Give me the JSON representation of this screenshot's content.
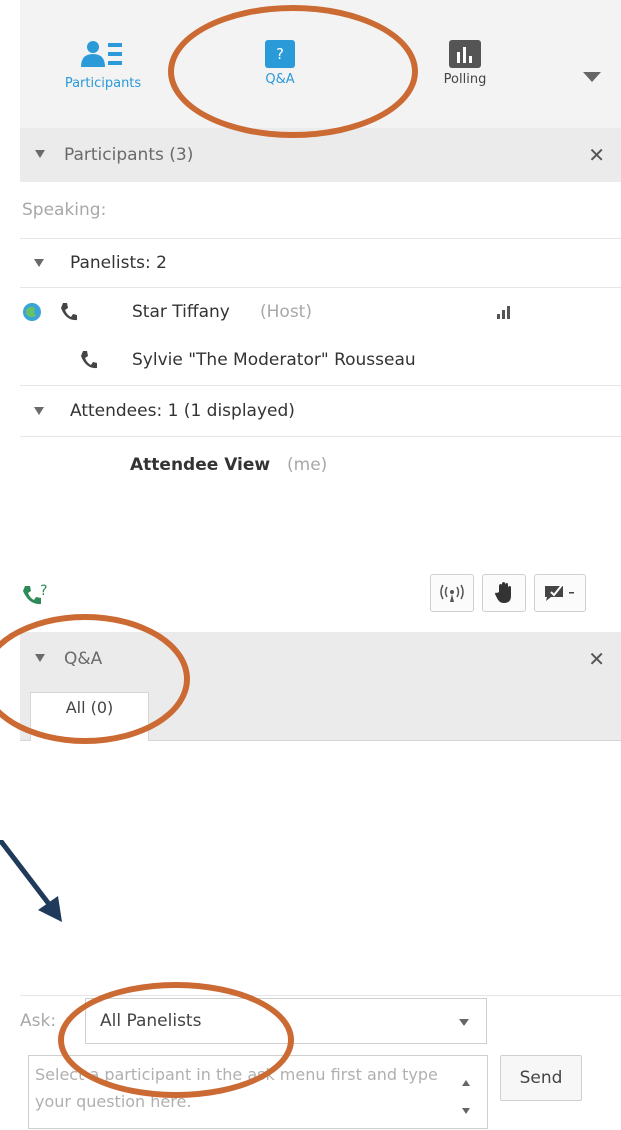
{
  "toolbar": {
    "participants_label": "Participants",
    "qa_label": "Q&A",
    "polling_label": "Polling",
    "qa_icon_glyph": "?"
  },
  "participants_panel": {
    "title": "Participants (3)",
    "speaking_label": "Speaking:",
    "panelists_header": "Panelists: 2",
    "panelists": [
      {
        "name": "Star Tiffany",
        "role": "(Host)"
      },
      {
        "name": "Sylvie \"The Moderator\" Rousseau",
        "role": ""
      }
    ],
    "attendees_header": "Attendees: 1 (1 displayed)",
    "attendees": [
      {
        "name": "Attendee View",
        "role": "(me)"
      }
    ]
  },
  "qa_panel": {
    "title": "Q&A",
    "tab_all": "All (0)",
    "ask_label": "Ask:",
    "ask_select_value": "All Panelists",
    "question_placeholder": "Select a participant in the ask menu first and type your question here.",
    "send_label": "Send"
  },
  "colors": {
    "accent_blue": "#2a9ad8",
    "annotation_orange": "#cc6a33",
    "arrow_navy": "#1f3a5a",
    "call_green": "#2e8b57"
  }
}
